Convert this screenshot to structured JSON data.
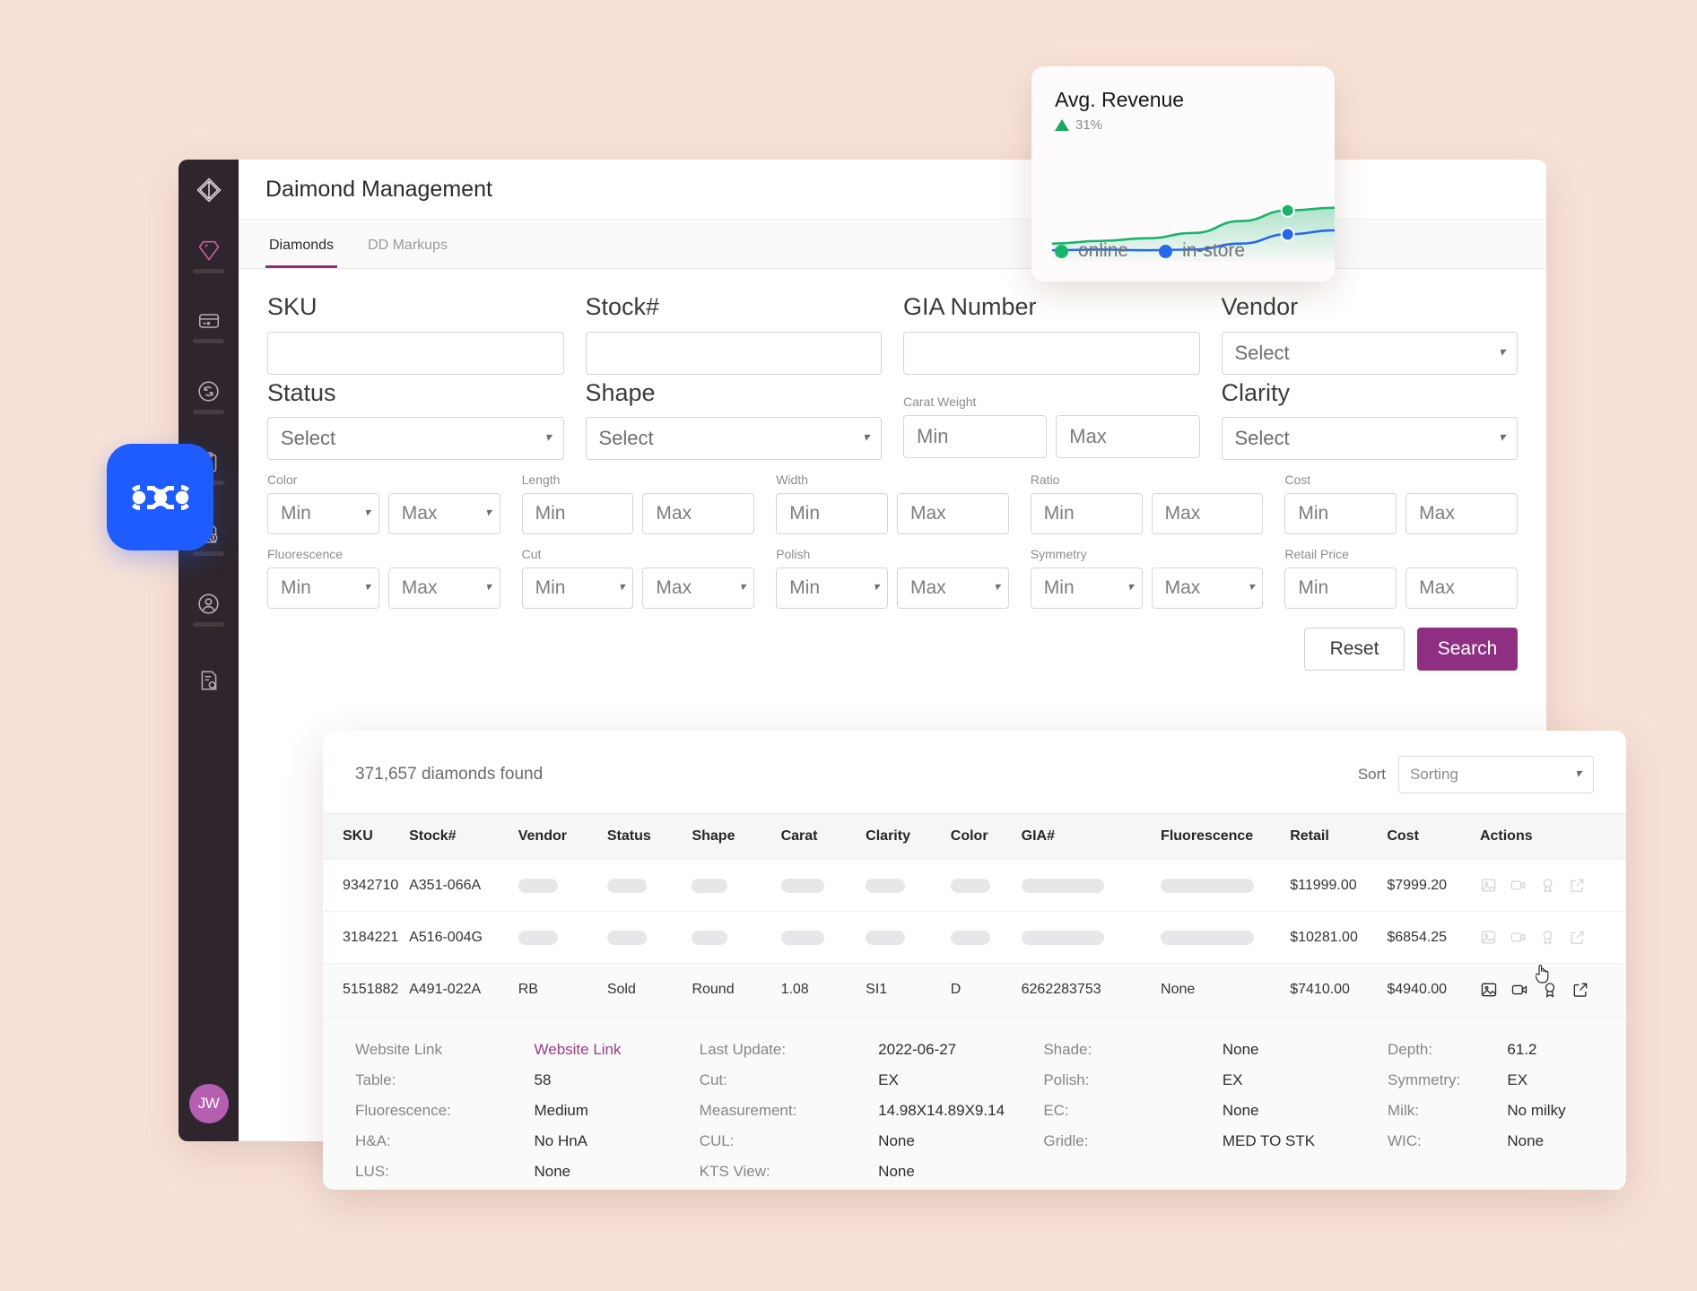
{
  "app": {
    "title": "Daimond Management",
    "logo_icon": "diamond-outline-icon"
  },
  "sidebar": {
    "items": [
      {
        "icon": "diamond-icon",
        "name": "diamonds",
        "active": true
      },
      {
        "icon": "credit-card-icon",
        "name": "payments",
        "active": false
      },
      {
        "icon": "sync-circle-icon",
        "name": "sync",
        "active": false
      },
      {
        "icon": "clipboard-icon",
        "name": "orders",
        "active": false
      },
      {
        "icon": "invoice-dollar-icon",
        "name": "invoices",
        "active": false
      },
      {
        "icon": "user-circle-icon",
        "name": "customers",
        "active": false
      },
      {
        "icon": "document-search-icon",
        "name": "reports",
        "active": false
      }
    ],
    "avatar_initials": "JW"
  },
  "tabs": [
    {
      "label": "Diamonds",
      "active": true
    },
    {
      "label": "DD Markups",
      "active": false
    }
  ],
  "filters": {
    "row1": [
      {
        "label": "SKU",
        "type": "text",
        "value": "",
        "placeholder": ""
      },
      {
        "label": "Stock#",
        "type": "text",
        "value": "",
        "placeholder": ""
      },
      {
        "label": "GIA Number",
        "type": "text",
        "value": "",
        "placeholder": ""
      },
      {
        "label": "Vendor",
        "type": "select",
        "value": "Select"
      }
    ],
    "row2": [
      {
        "label": "Status",
        "type": "select",
        "value": "Select"
      },
      {
        "label": "Shape",
        "type": "select",
        "value": "Select"
      },
      {
        "label": "Carat Weight",
        "type": "range",
        "min": "Min",
        "max": "Max",
        "small_label": true
      },
      {
        "label": "Clarity",
        "type": "select",
        "value": "Select"
      }
    ],
    "row3": [
      {
        "label": "Color",
        "type": "range-select",
        "min": "Min",
        "max": "Max"
      },
      {
        "label": "Length",
        "type": "range",
        "min": "Min",
        "max": "Max"
      },
      {
        "label": "Width",
        "type": "range",
        "min": "Min",
        "max": "Max"
      },
      {
        "label": "Ratio",
        "type": "range",
        "min": "Min",
        "max": "Max"
      },
      {
        "label": "Cost",
        "type": "range",
        "min": "Min",
        "max": "Max"
      }
    ],
    "row4": [
      {
        "label": "Fluorescence",
        "type": "range-select",
        "min": "Min",
        "max": "Max"
      },
      {
        "label": "Cut",
        "type": "range-select",
        "min": "Min",
        "max": "Max"
      },
      {
        "label": "Polish",
        "type": "range-select",
        "min": "Min",
        "max": "Max"
      },
      {
        "label": "Symmetry",
        "type": "range-select",
        "min": "Min",
        "max": "Max"
      },
      {
        "label": "Retail Price",
        "type": "range",
        "min": "Min",
        "max": "Max"
      }
    ],
    "reset_label": "Reset",
    "search_label": "Search"
  },
  "kpi": {
    "title": "Avg. Revenue",
    "delta": "31%",
    "delta_direction": "up",
    "delta_color": "#17a862",
    "legend": [
      {
        "label": "online",
        "color": "#19b46b"
      },
      {
        "label": "in-store",
        "color": "#2569e8"
      }
    ]
  },
  "chart_data": {
    "type": "line",
    "title": "Avg. Revenue",
    "xlabel": "",
    "ylabel": "",
    "grid": false,
    "legend_position": "bottom-left",
    "annotations": [
      "31% up"
    ],
    "x": [
      0,
      1,
      2,
      3,
      4,
      5,
      6
    ],
    "series": [
      {
        "name": "online",
        "color": "#19b46b",
        "values": [
          22,
          26,
          30,
          38,
          56,
          72,
          76
        ],
        "marker_index": 5,
        "area": true
      },
      {
        "name": "in-store",
        "color": "#2569e8",
        "values": [
          12,
          13,
          12,
          13,
          22,
          36,
          42
        ],
        "marker_index": 5,
        "area": false
      }
    ],
    "ylim": [
      0,
      100
    ]
  },
  "results": {
    "count_text": "371,657 diamonds found",
    "sort_label": "Sort",
    "sort_value": "Sorting",
    "columns": [
      "SKU",
      "Stock#",
      "Vendor",
      "Status",
      "Shape",
      "Carat",
      "Clarity",
      "Color",
      "GIA#",
      "Fluorescence",
      "Retail",
      "Cost",
      "Actions"
    ],
    "rows": [
      {
        "loading": true,
        "sku": "9342710",
        "stock": "A351-066A",
        "vendor": "",
        "status": "",
        "shape": "",
        "carat": "",
        "clarity": "",
        "color": "",
        "gia": "",
        "fluorescence": "",
        "retail": "$11999.00",
        "cost": "$7999.20"
      },
      {
        "loading": true,
        "sku": "3184221",
        "stock": "A516-004G",
        "vendor": "",
        "status": "",
        "shape": "",
        "carat": "",
        "clarity": "",
        "color": "",
        "gia": "",
        "fluorescence": "",
        "retail": "$10281.00",
        "cost": "$6854.25"
      },
      {
        "loading": false,
        "expanded": true,
        "sku": "5151882",
        "stock": "A491-022A",
        "vendor": "RB",
        "status": "Sold",
        "shape": "Round",
        "carat": "1.08",
        "clarity": "SI1",
        "color": "D",
        "gia": "6262283753",
        "fluorescence": "None",
        "retail": "$7410.00",
        "cost": "$4940.00"
      }
    ],
    "action_icons": [
      "image-icon",
      "video-icon",
      "certificate-icon",
      "external-link-icon"
    ],
    "detail": {
      "col1": [
        {
          "key": "Website Link",
          "value": "Website Link",
          "link": true
        },
        {
          "key": "Table:",
          "value": "58"
        },
        {
          "key": "Fluorescence:",
          "value": "Medium"
        },
        {
          "key": "H&A:",
          "value": "No HnA"
        },
        {
          "key": "LUS:",
          "value": "None"
        }
      ],
      "col2": [
        {
          "key": "Last Update:",
          "value": "2022-06-27"
        },
        {
          "key": "Cut:",
          "value": "EX"
        },
        {
          "key": "Measurement:",
          "value": "14.98X14.89X9.14"
        },
        {
          "key": "CUL:",
          "value": "None"
        },
        {
          "key": "KTS View:",
          "value": "None"
        }
      ],
      "col3": [
        {
          "key": "Shade:",
          "value": "None"
        },
        {
          "key": "Polish:",
          "value": "EX"
        },
        {
          "key": "EC:",
          "value": "None"
        },
        {
          "key": "Gridle:",
          "value": "MED TO STK"
        }
      ],
      "col4": [
        {
          "key": "Depth:",
          "value": "61.2"
        },
        {
          "key": "Symmetry:",
          "value": "EX"
        },
        {
          "key": "Milk:",
          "value": "No milky"
        },
        {
          "key": "WIC:",
          "value": "None"
        }
      ]
    }
  },
  "brand_logo": {
    "name": "blue-app-logo",
    "color": "#1f5cff"
  },
  "colors": {
    "background": "#f8e2d7",
    "sidebar": "#2e262c",
    "accent_purple": "#8e2f82",
    "accent_blue": "#1f5cff",
    "green": "#19b46b"
  }
}
